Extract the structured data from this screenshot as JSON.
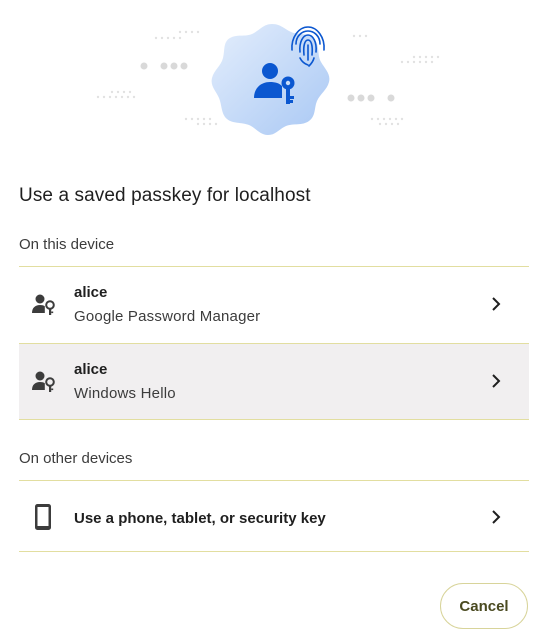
{
  "dialog": {
    "title": "Use a saved passkey for localhost"
  },
  "sections": {
    "this_device_label": "On this device",
    "other_devices_label": "On other devices"
  },
  "passkeys": [
    {
      "username": "alice",
      "provider": "Google Password Manager",
      "icon": "passkey-user-icon"
    },
    {
      "username": "alice",
      "provider": "Windows Hello",
      "icon": "passkey-user-icon",
      "highlighted": true
    }
  ],
  "other_device_option": {
    "label": "Use a phone, tablet, or security key",
    "icon": "phone-icon"
  },
  "buttons": {
    "cancel": "Cancel"
  },
  "colors": {
    "accent_blue": "#0b57d0",
    "divider": "#e2dea0",
    "row_highlight": "#f1eff0"
  }
}
